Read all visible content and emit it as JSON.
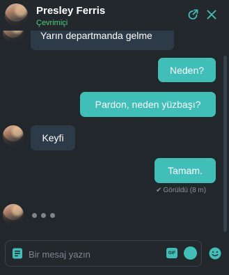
{
  "header": {
    "contact_name": "Presley Ferris",
    "contact_status": "Çevrimiçi",
    "icons": [
      "external-link-icon",
      "close-icon"
    ]
  },
  "messages": [
    {
      "direction": "incoming",
      "text": "Yarın departmanda gelme",
      "avatar": true
    },
    {
      "direction": "outgoing",
      "text": "Neden?"
    },
    {
      "direction": "outgoing",
      "text": "Pardon, neden yüzbaşı?"
    },
    {
      "direction": "incoming",
      "text": "Keyfi",
      "avatar": true
    },
    {
      "direction": "outgoing",
      "text": "Tamam."
    }
  ],
  "read_receipt": "Görüldü (8 m)",
  "composer": {
    "placeholder": "Bir mesaj yazın",
    "gif_label": "GIF",
    "icons": [
      "document-icon",
      "gif-icon",
      "send-icon",
      "emoji-icon"
    ]
  },
  "colors": {
    "accent": "#3fbfb7",
    "online": "#4cd07d",
    "incoming_bubble": "#2d3a47",
    "background": "#22272c"
  }
}
